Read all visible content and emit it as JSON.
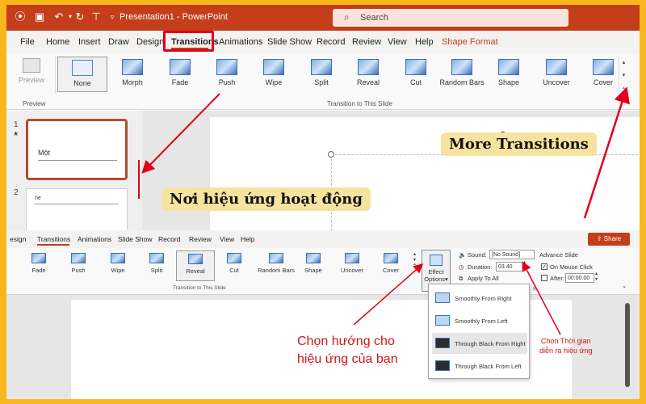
{
  "titlebar": {
    "document_title": "Presentation1 - PowerPoint",
    "search_placeholder": "Search"
  },
  "ribbon_tabs": [
    "File",
    "Home",
    "Insert",
    "Draw",
    "Design",
    "Transitions",
    "Animations",
    "Slide Show",
    "Record",
    "Review",
    "View",
    "Help",
    "Shape Format"
  ],
  "active_tab": "Transitions",
  "preview": {
    "label": "Preview",
    "group_label": "Preview"
  },
  "transitions": [
    "None",
    "Morph",
    "Fade",
    "Push",
    "Wipe",
    "Split",
    "Reveal",
    "Cut",
    "Random Bars",
    "Shape",
    "Uncover",
    "Cover"
  ],
  "selected_transition": "None",
  "transition_group_label": "Transition to This Slide",
  "slides": {
    "numbers": [
      "1",
      "2"
    ],
    "star": "★",
    "slide1_text": "Một",
    "slide2_text": "ne"
  },
  "callouts": {
    "more_transitions": "More Transitions",
    "effect_area": "Nơi hiệu ứng hoạt động",
    "effect_direction_line1": "Chọn hướng cho",
    "effect_direction_line2": "hiệu ứng của bạn",
    "duration_line1": "Chọn Thời gian",
    "duration_line2": "diễn ra hiệu ứng"
  },
  "lower": {
    "tabs": [
      "esign",
      "Transitions",
      "Animations",
      "Slide Show",
      "Record",
      "Review",
      "View",
      "Help"
    ],
    "share_label": "Share",
    "share_icon": "share-icon",
    "transitions": [
      "Fade",
      "Push",
      "Wipe",
      "Split",
      "Reveal",
      "Cut",
      "Random Bars",
      "Shape",
      "Uncover",
      "Cover"
    ],
    "selected_transition": "Reveal",
    "group_label": "Transition to This Slide",
    "effect_options_line1": "Effect",
    "effect_options_line2": "Options",
    "sound_label": "Sound:",
    "sound_value": "[No Sound]",
    "duration_label": "Duration:",
    "duration_value": "03.40",
    "apply_all": "Apply To All",
    "advance_label": "Advance Slide",
    "on_mouse_click": "On Mouse Click",
    "after_label": "After:",
    "after_value": "00:00.00",
    "timing_fragment": "g"
  },
  "effect_options": [
    "Smoothly From Right",
    "Smoothly From Left",
    "Through Black From Right",
    "Through Black From Left"
  ],
  "selected_effect": "Through Black From Right",
  "colors": {
    "title_bar": "#c43e1c",
    "frame": "#f7b71d",
    "callout_bg": "#f6e39f",
    "arrow_red": "#e0001a"
  }
}
